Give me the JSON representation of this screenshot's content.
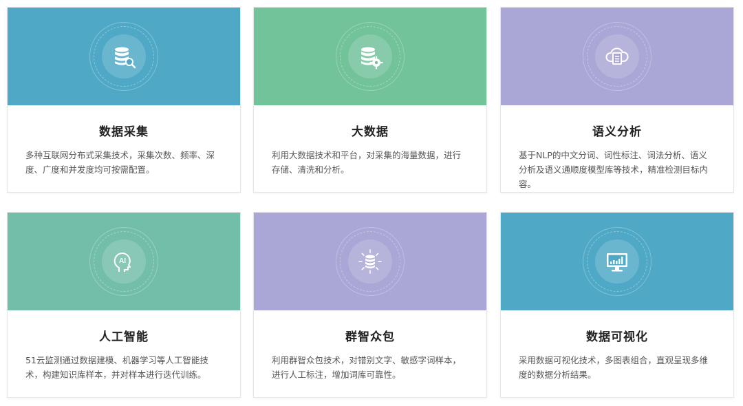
{
  "colors": {
    "blue": "#4fa9c6",
    "green": "#72c29a",
    "lavender": "#aaa6d6",
    "teal": "#73bea9"
  },
  "cards": [
    {
      "icon": "database-search-icon",
      "color": "#4fa9c6",
      "title": "数据采集",
      "desc": "多种互联网分布式采集技术，采集次数、频率、深度、广度和并发度均可按需配置。"
    },
    {
      "icon": "database-gear-icon",
      "color": "#72c29a",
      "title": "大数据",
      "desc": "利用大数据技术和平台，对采集的海量数据，进行存储、清洗和分析。"
    },
    {
      "icon": "cloud-document-icon",
      "color": "#aaa6d6",
      "title": "语义分析",
      "desc": "基于NLP的中文分词、词性标注、词法分析、语义分析及语义通顺度模型库等技术，精准检测目标内容。"
    },
    {
      "icon": "ai-head-icon",
      "color": "#73bea9",
      "title": "人工智能",
      "desc": "51云监测通过数据建模、机器学习等人工智能技术，构建知识库样本，并对样本进行迭代训练。"
    },
    {
      "icon": "database-burst-icon",
      "color": "#aaa6d6",
      "title": "群智众包",
      "desc": "利用群智众包技术，对错别文字、敏感字词样本，进行人工标注，增加词库可靠性。"
    },
    {
      "icon": "monitor-chart-icon",
      "color": "#4fa9c6",
      "title": "数据可视化",
      "desc": "采用数据可视化技术，多图表组合，直观呈现多维度的数据分析结果。"
    }
  ]
}
